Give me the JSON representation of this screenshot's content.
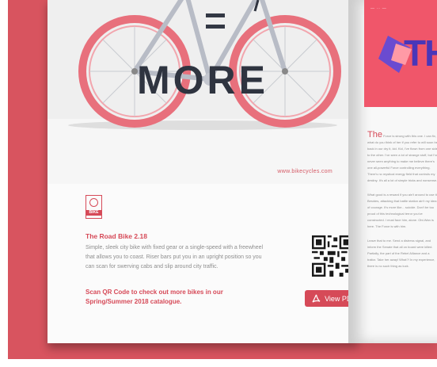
{
  "bike_page": {
    "photo_text": "MORE",
    "photo_url": "www.bikecycles.com",
    "logo_label": "BIKE",
    "product_title": "The Road Bike 2.18",
    "product_description": "Simple, sleek city bike with fixed gear or a single-speed with a freewheel that allows you to coast. Riser bars put you in an upright position so you can scan for swerving cabs and slip around city traffic.",
    "cta": "Scan QR Code to check out more bikes in our Spring/Summer 2018 catalogue.",
    "view_pdf_label": "View PDF"
  },
  "right_page": {
    "cover_big_text": "TH",
    "lead_word": "The",
    "para1": "Force is strong with this one. I can fix, what do you think of her if you refer to will soon be back in our dry it, kid. Kid, I've flown from one side to the other. I've seen a lot of strange stuff, but I've never seen anything to make me believe there's one all-powerful Force controlling everything. There's no mystical energy field that controls my destiny. It's all a lot of simple tricks and nonsense.",
    "para2": "What good is a reward if you ain't around to use it? Besides, attacking that battle station ain't my idea of courage. It's more like... suicide. Don't be too proud of this technological terror you've constructed. I must face him, alone. Obi-Wan is here. The Force is with him.",
    "para3": "Leave that to me. Send a distress signal, and inform the Senate that all on board were killed. Partially, the part of the Rebel Alliance and a traitor. Take her away! What?! In my experience, there is no such thing as luck."
  },
  "colors": {
    "background": "#d8545f",
    "accent": "#d64a58",
    "cover": "#f0566a",
    "cover_text": "#4a36b8"
  }
}
